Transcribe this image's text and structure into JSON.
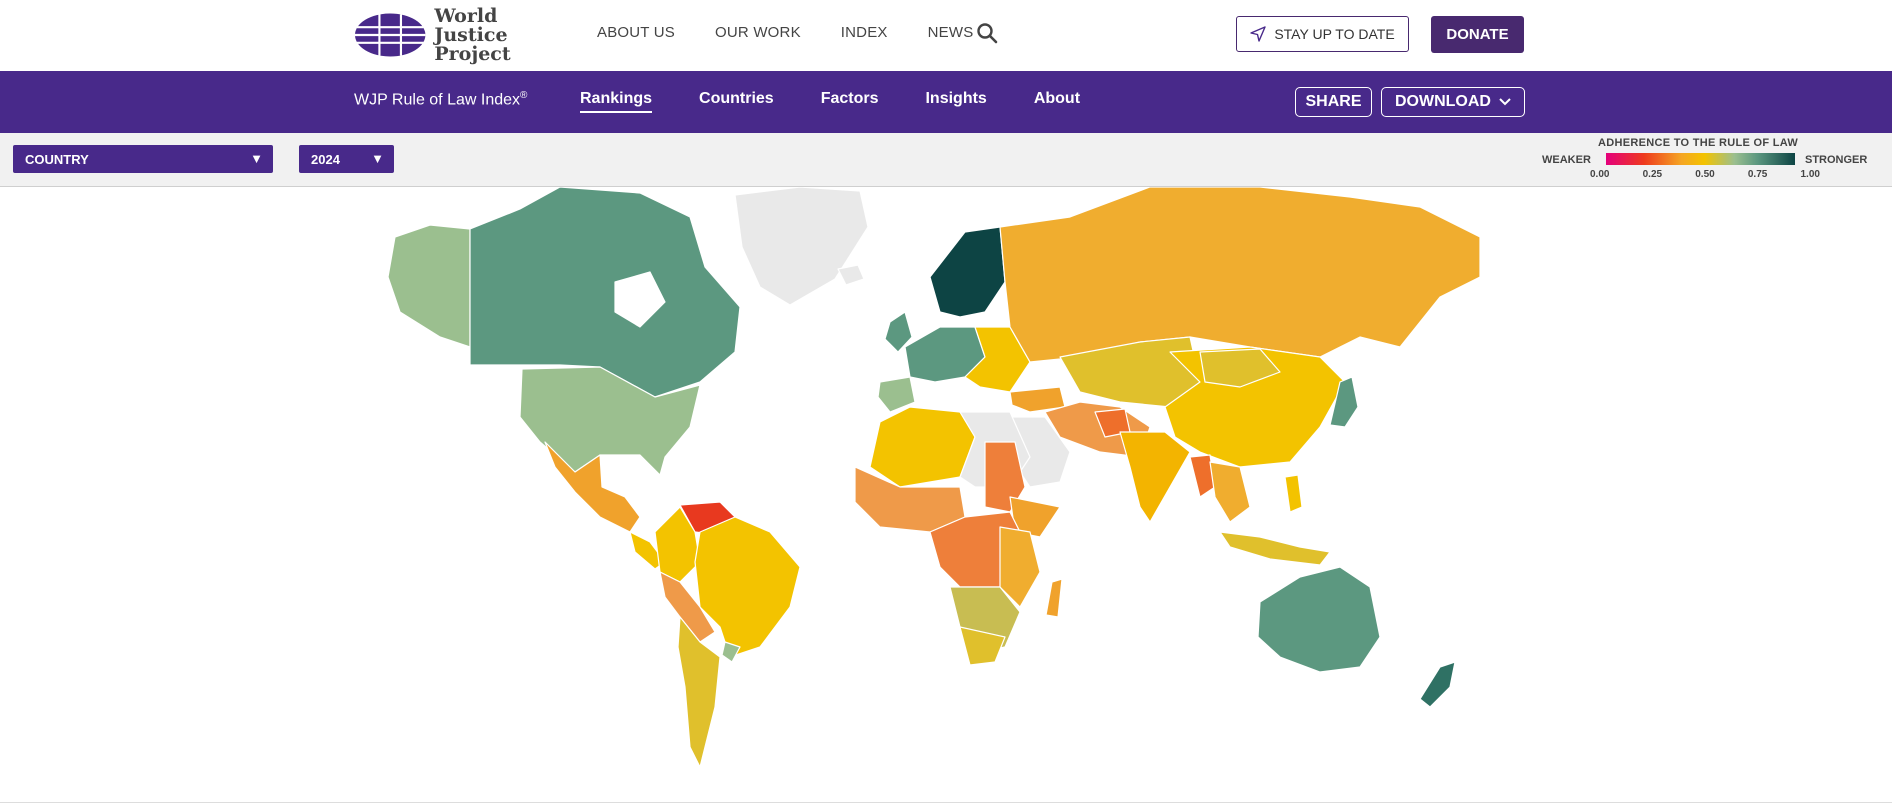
{
  "header": {
    "logo_line1": "World Justice",
    "logo_line2": "Project",
    "nav": [
      "ABOUT US",
      "OUR WORK",
      "INDEX",
      "NEWS"
    ],
    "stay_label": "STAY UP TO DATE",
    "donate_label": "DONATE"
  },
  "subheader": {
    "title": "WJP Rule of Law Index",
    "title_mark": "®",
    "tabs": [
      "Rankings",
      "Countries",
      "Factors",
      "Insights",
      "About"
    ],
    "active_tab": "Rankings",
    "share_label": "SHARE",
    "download_label": "DOWNLOAD"
  },
  "filters": {
    "country_value": "COUNTRY",
    "year_value": "2024"
  },
  "legend": {
    "title": "ADHERENCE TO THE RULE OF LAW",
    "weaker": "WEAKER",
    "stronger": "STRONGER",
    "ticks": [
      "0.00",
      "0.25",
      "0.50",
      "0.75",
      "1.00"
    ]
  },
  "colors": {
    "brand_purple": "#48298a",
    "strong": "#0d4444",
    "green_teal": "#5c9880",
    "light_green": "#9bbf8f",
    "yellow": "#f3c300",
    "orange": "#f0a22c",
    "dark_orange": "#ee7f3a",
    "red": "#e8391f",
    "no_data": "#e6e6e6"
  },
  "icons": {
    "search": "search-icon",
    "send": "send-icon",
    "chevron": "chevron-down-icon",
    "caret": "caret-down-icon"
  }
}
